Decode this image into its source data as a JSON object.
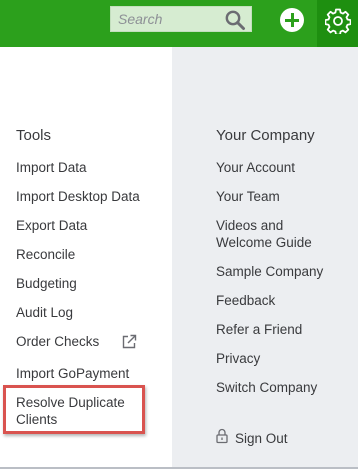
{
  "header": {
    "search_placeholder": "Search",
    "search_icon": "search-icon",
    "add_icon": "plus-circle-icon",
    "settings_icon": "gear-icon",
    "brand_color": "#2ca01c"
  },
  "tools": {
    "title": "Tools",
    "items": [
      {
        "label": "Import Data"
      },
      {
        "label": "Import Desktop Data"
      },
      {
        "label": "Export Data"
      },
      {
        "label": "Reconcile"
      },
      {
        "label": "Budgeting"
      },
      {
        "label": "Audit Log"
      },
      {
        "label": "Order Checks",
        "icon": "external-link-icon"
      },
      {
        "label": "Import GoPayment"
      },
      {
        "label_line1": "Resolve Duplicate",
        "label_line2": "Clients",
        "highlighted": true,
        "highlight_color": "#d9534f"
      }
    ]
  },
  "your_company": {
    "title": "Your Company",
    "items": [
      {
        "label": "Your Account"
      },
      {
        "label": "Your Team"
      },
      {
        "label_line1": "Videos and",
        "label_line2": "Welcome Guide"
      },
      {
        "label": "Sample Company"
      },
      {
        "label": "Feedback"
      },
      {
        "label": "Refer a Friend"
      },
      {
        "label": "Privacy"
      },
      {
        "label": "Switch Company"
      }
    ],
    "sign_out": {
      "label": "Sign Out",
      "icon": "lock-icon"
    }
  }
}
